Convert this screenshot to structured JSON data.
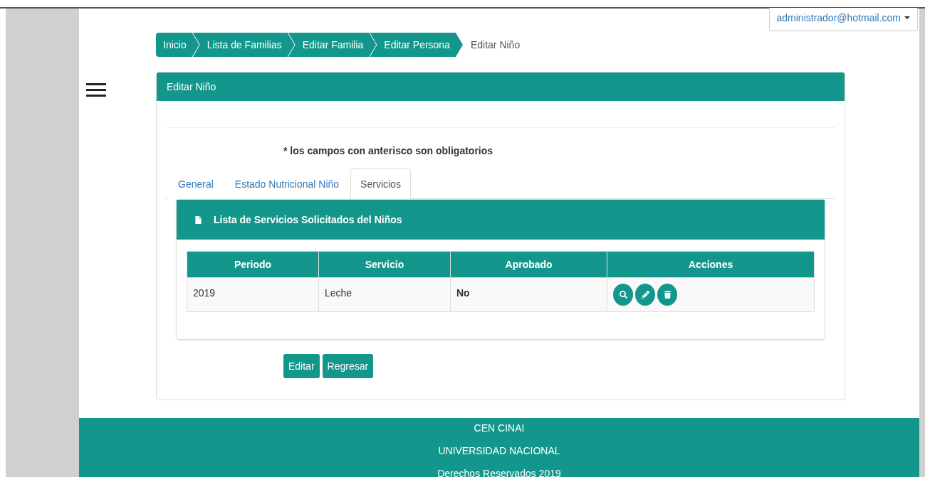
{
  "user_menu": {
    "label": "administrador@hotmail.com"
  },
  "breadcrumb": [
    {
      "label": "Inicio",
      "selected": false
    },
    {
      "label": "Lista de Familias",
      "selected": false
    },
    {
      "label": "Editar Familia",
      "selected": false
    },
    {
      "label": "Editar Persona",
      "selected": false
    },
    {
      "label": "Editar Niño",
      "selected": true
    }
  ],
  "panel": {
    "title": "Editar Niño",
    "note": "* los campos con anterisco son obligatorios",
    "tabs": [
      {
        "label": "General",
        "selected": false
      },
      {
        "label": "Estado Nutricional Niño",
        "selected": false
      },
      {
        "label": "Servicios",
        "selected": true
      }
    ],
    "services": {
      "title": "Lista de Servicios Solicitados del Niños",
      "table": {
        "columns": [
          "Periodo",
          "Servicio",
          "Aprobado",
          "Acciones"
        ],
        "rows": [
          {
            "cells": [
              "2019",
              "Leche",
              "No"
            ],
            "actions": [
              {
                "kind": "view"
              },
              {
                "kind": "edit"
              },
              {
                "kind": "delete"
              }
            ]
          }
        ]
      }
    },
    "buttons": [
      "Editar",
      "Regresar"
    ]
  },
  "footer": [
    "CEN CINAI",
    "UNIVERSIDAD NACIONAL",
    "Derechos Reservados 2019"
  ]
}
